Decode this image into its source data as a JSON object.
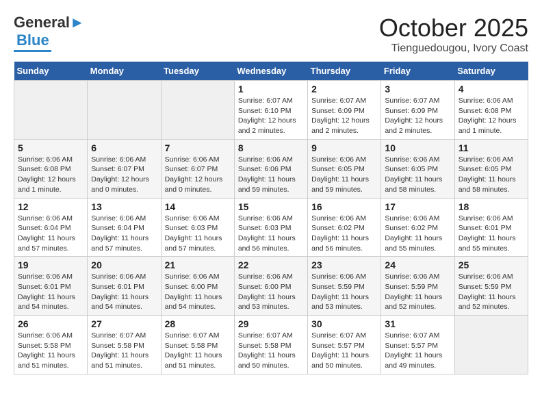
{
  "header": {
    "logo_general": "General",
    "logo_blue": "Blue",
    "month": "October 2025",
    "location": "Tienguedougou, Ivory Coast"
  },
  "days_of_week": [
    "Sunday",
    "Monday",
    "Tuesday",
    "Wednesday",
    "Thursday",
    "Friday",
    "Saturday"
  ],
  "weeks": [
    [
      {
        "day": "",
        "info": ""
      },
      {
        "day": "",
        "info": ""
      },
      {
        "day": "",
        "info": ""
      },
      {
        "day": "1",
        "info": "Sunrise: 6:07 AM\nSunset: 6:10 PM\nDaylight: 12 hours and 2 minutes."
      },
      {
        "day": "2",
        "info": "Sunrise: 6:07 AM\nSunset: 6:09 PM\nDaylight: 12 hours and 2 minutes."
      },
      {
        "day": "3",
        "info": "Sunrise: 6:07 AM\nSunset: 6:09 PM\nDaylight: 12 hours and 2 minutes."
      },
      {
        "day": "4",
        "info": "Sunrise: 6:06 AM\nSunset: 6:08 PM\nDaylight: 12 hours and 1 minute."
      }
    ],
    [
      {
        "day": "5",
        "info": "Sunrise: 6:06 AM\nSunset: 6:08 PM\nDaylight: 12 hours and 1 minute."
      },
      {
        "day": "6",
        "info": "Sunrise: 6:06 AM\nSunset: 6:07 PM\nDaylight: 12 hours and 0 minutes."
      },
      {
        "day": "7",
        "info": "Sunrise: 6:06 AM\nSunset: 6:07 PM\nDaylight: 12 hours and 0 minutes."
      },
      {
        "day": "8",
        "info": "Sunrise: 6:06 AM\nSunset: 6:06 PM\nDaylight: 11 hours and 59 minutes."
      },
      {
        "day": "9",
        "info": "Sunrise: 6:06 AM\nSunset: 6:05 PM\nDaylight: 11 hours and 59 minutes."
      },
      {
        "day": "10",
        "info": "Sunrise: 6:06 AM\nSunset: 6:05 PM\nDaylight: 11 hours and 58 minutes."
      },
      {
        "day": "11",
        "info": "Sunrise: 6:06 AM\nSunset: 6:05 PM\nDaylight: 11 hours and 58 minutes."
      }
    ],
    [
      {
        "day": "12",
        "info": "Sunrise: 6:06 AM\nSunset: 6:04 PM\nDaylight: 11 hours and 57 minutes."
      },
      {
        "day": "13",
        "info": "Sunrise: 6:06 AM\nSunset: 6:04 PM\nDaylight: 11 hours and 57 minutes."
      },
      {
        "day": "14",
        "info": "Sunrise: 6:06 AM\nSunset: 6:03 PM\nDaylight: 11 hours and 57 minutes."
      },
      {
        "day": "15",
        "info": "Sunrise: 6:06 AM\nSunset: 6:03 PM\nDaylight: 11 hours and 56 minutes."
      },
      {
        "day": "16",
        "info": "Sunrise: 6:06 AM\nSunset: 6:02 PM\nDaylight: 11 hours and 56 minutes."
      },
      {
        "day": "17",
        "info": "Sunrise: 6:06 AM\nSunset: 6:02 PM\nDaylight: 11 hours and 55 minutes."
      },
      {
        "day": "18",
        "info": "Sunrise: 6:06 AM\nSunset: 6:01 PM\nDaylight: 11 hours and 55 minutes."
      }
    ],
    [
      {
        "day": "19",
        "info": "Sunrise: 6:06 AM\nSunset: 6:01 PM\nDaylight: 11 hours and 54 minutes."
      },
      {
        "day": "20",
        "info": "Sunrise: 6:06 AM\nSunset: 6:01 PM\nDaylight: 11 hours and 54 minutes."
      },
      {
        "day": "21",
        "info": "Sunrise: 6:06 AM\nSunset: 6:00 PM\nDaylight: 11 hours and 54 minutes."
      },
      {
        "day": "22",
        "info": "Sunrise: 6:06 AM\nSunset: 6:00 PM\nDaylight: 11 hours and 53 minutes."
      },
      {
        "day": "23",
        "info": "Sunrise: 6:06 AM\nSunset: 5:59 PM\nDaylight: 11 hours and 53 minutes."
      },
      {
        "day": "24",
        "info": "Sunrise: 6:06 AM\nSunset: 5:59 PM\nDaylight: 11 hours and 52 minutes."
      },
      {
        "day": "25",
        "info": "Sunrise: 6:06 AM\nSunset: 5:59 PM\nDaylight: 11 hours and 52 minutes."
      }
    ],
    [
      {
        "day": "26",
        "info": "Sunrise: 6:06 AM\nSunset: 5:58 PM\nDaylight: 11 hours and 51 minutes."
      },
      {
        "day": "27",
        "info": "Sunrise: 6:07 AM\nSunset: 5:58 PM\nDaylight: 11 hours and 51 minutes."
      },
      {
        "day": "28",
        "info": "Sunrise: 6:07 AM\nSunset: 5:58 PM\nDaylight: 11 hours and 51 minutes."
      },
      {
        "day": "29",
        "info": "Sunrise: 6:07 AM\nSunset: 5:58 PM\nDaylight: 11 hours and 50 minutes."
      },
      {
        "day": "30",
        "info": "Sunrise: 6:07 AM\nSunset: 5:57 PM\nDaylight: 11 hours and 50 minutes."
      },
      {
        "day": "31",
        "info": "Sunrise: 6:07 AM\nSunset: 5:57 PM\nDaylight: 11 hours and 49 minutes."
      },
      {
        "day": "",
        "info": ""
      }
    ]
  ]
}
